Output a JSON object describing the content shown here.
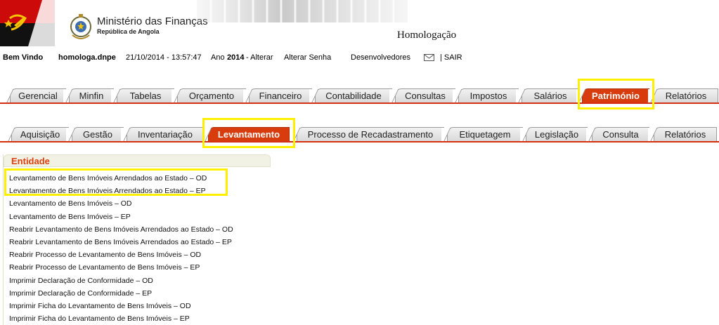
{
  "header": {
    "ministry_title": "Ministério das Finanças",
    "ministry_subtitle": "República de Angola",
    "environment": "Homologação"
  },
  "infobar": {
    "welcome": "Bem Vindo",
    "user": "homologa.dnpe",
    "datetime": "21/10/2014 - 13:57:47",
    "year_label": "Ano",
    "year": "2014",
    "year_change": "- Alterar",
    "change_password": "Alterar Senha",
    "developers": "Desenvolvedores",
    "logout": "| SAIR"
  },
  "main_tabs": [
    "Gerencial",
    "Minfin",
    "Tabelas",
    "Orçamento",
    "Financeiro",
    "Contabilidade",
    "Consultas",
    "Impostos",
    "Salários",
    "Património",
    "Relatórios"
  ],
  "main_tab_active": "Património",
  "sub_tabs": [
    "Aquisição",
    "Gestão",
    "Inventariação",
    "Levantamento",
    "Processo de Recadastramento",
    "Etiquetagem",
    "Legislação",
    "Consulta",
    "Relatórios"
  ],
  "sub_tab_active": "Levantamento",
  "panel": {
    "title": "Entidade",
    "items": [
      "Levantamento de Bens Imóveis Arrendados ao Estado – OD",
      "Levantamento de Bens Imóveis Arrendados ao Estado – EP",
      "Levantamento de Bens Imóveis – OD",
      "Levantamento de Bens Imóveis – EP",
      "Reabrir Levantamento de Bens Imóveis Arrendados ao Estado – OD",
      "Reabrir Levantamento de Bens Imóveis Arrendados ao Estado – EP",
      "Reabrir Processo de Levantamento de Bens Imóveis – OD",
      "Reabrir Processo de Levantamento de Bens Imóveis – EP",
      "Imprimir Declaração de Conformidade – OD",
      "Imprimir Declaração de Conformidade – EP",
      "Imprimir Ficha do Levantamento de Bens Imóveis – OD",
      "Imprimir Ficha do Levantamento de Bens Imóveis – EP"
    ]
  },
  "colors": {
    "accent": "#d83b0c",
    "highlight": "#ffef00",
    "panel_title": "#e0400e"
  }
}
